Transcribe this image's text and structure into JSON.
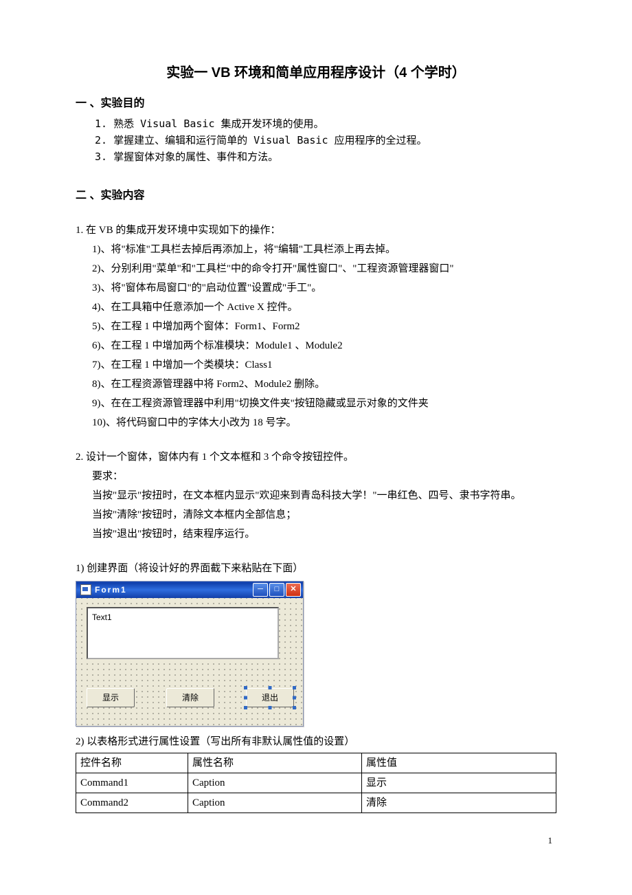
{
  "title": "实验一 VB 环境和简单应用程序设计（4 个学时）",
  "section1": {
    "heading": "一 、实验目的",
    "items": [
      "1.  熟悉 Visual Basic 集成开发环境的使用。",
      "2.  掌握建立、编辑和运行简单的 Visual Basic 应用程序的全过程。",
      "3.  掌握窗体对象的属性、事件和方法。"
    ]
  },
  "section2": {
    "heading": "二 、实验内容",
    "q1_intro": "1. 在 VB 的集成开发环境中实现如下的操作：",
    "q1_items": [
      "1)、将\"标准\"工具栏去掉后再添加上，将\"编辑\"工具栏添上再去掉。",
      "2)、分别利用\"菜单\"和\"工具栏\"中的命令打开\"属性窗口\"、\"工程资源管理器窗口\"",
      "3)、将\"窗体布局窗口\"的\"启动位置\"设置成\"手工\"。",
      "4)、在工具箱中任意添加一个 Active X 控件。",
      "5)、在工程 1 中增加两个窗体：Form1、Form2",
      "6)、在工程 1 中增加两个标准模块：Module1 、Module2",
      "7)、在工程 1 中增加一个类模块：Class1",
      "8)、在工程资源管理器中将 Form2、Module2 删除。",
      "9)、在在工程资源管理器中利用\"切换文件夹\"按钮隐藏或显示对象的文件夹",
      "10)、将代码窗口中的字体大小改为 18 号字。"
    ],
    "q2_intro": "2.  设计一个窗体，窗体内有 1 个文本框和 3 个命令按钮控件。",
    "q2_req_label": "要求：",
    "q2_reqs": [
      "当按\"显示\"按扭时，在文本框内显示\"欢迎来到青岛科技大学！\"一串红色、四号、隶书字符串。",
      "当按\"清除\"按钮时，清除文本框内全部信息；",
      "当按\"退出\"按钮时，结束程序运行。"
    ],
    "step1_label": "1)   创建界面（将设计好的界面截下来粘贴在下面）",
    "step2_label": "2)   以表格形式进行属性设置（写出所有非默认属性值的设置）"
  },
  "form_mock": {
    "title": "Form1",
    "textbox_value": "Text1",
    "buttons": [
      "显示",
      "清除",
      "退出"
    ]
  },
  "prop_table": {
    "headers": [
      "控件名称",
      "属性名称",
      "属性值"
    ],
    "rows": [
      [
        "Command1",
        "Caption",
        "显示"
      ],
      [
        "Command2",
        "Caption",
        "清除"
      ]
    ]
  },
  "page_number": "1"
}
